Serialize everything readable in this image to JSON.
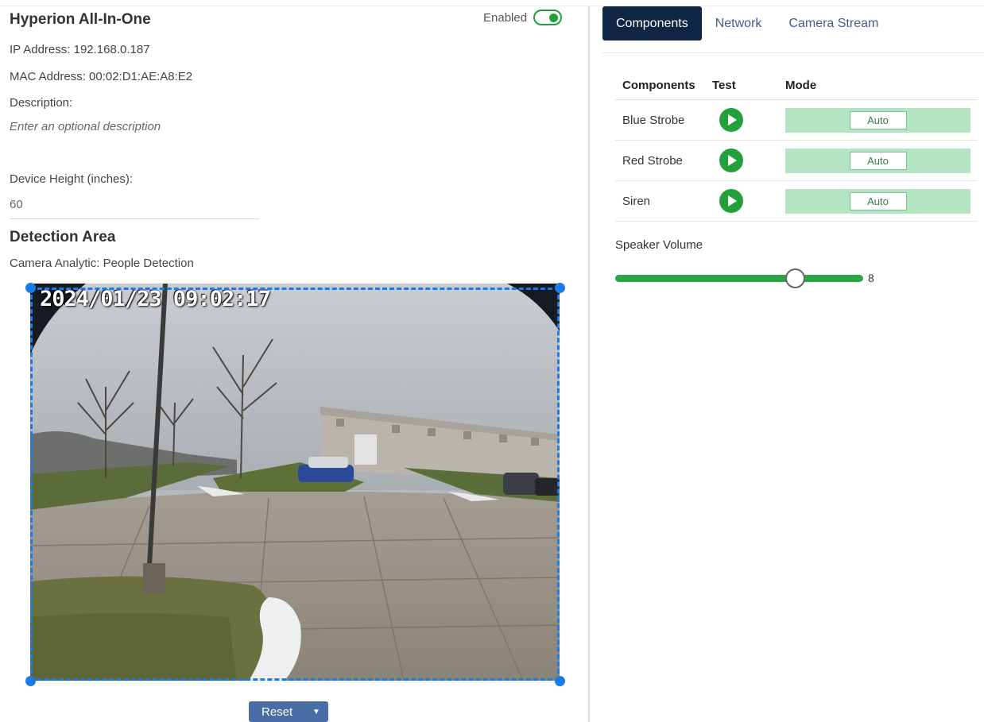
{
  "device": {
    "title": "Hyperion All-In-One",
    "enabled_label": "Enabled",
    "enabled": true,
    "ip_label": "IP Address:",
    "ip_value": "192.168.0.187",
    "mac_label": "MAC Address:",
    "mac_value": "00:02:D1:AE:A8:E2",
    "description_label": "Description:",
    "description_placeholder": "Enter an optional description",
    "height_label": "Device Height (inches):",
    "height_value": "60"
  },
  "detection": {
    "title": "Detection Area",
    "analytic_label": "Camera Analytic:",
    "analytic_value": "People Detection",
    "timestamp": "2024/01/23 09:02:17",
    "reset_label": "Reset"
  },
  "tabs": [
    {
      "label": "Components",
      "active": true
    },
    {
      "label": "Network",
      "active": false
    },
    {
      "label": "Camera Stream",
      "active": false
    }
  ],
  "components_table": {
    "headers": [
      "Components",
      "Test",
      "Mode"
    ],
    "rows": [
      {
        "name": "Blue Strobe",
        "mode": "Auto"
      },
      {
        "name": "Red Strobe",
        "mode": "Auto"
      },
      {
        "name": "Siren",
        "mode": "Auto"
      }
    ]
  },
  "speaker": {
    "label": "Speaker Volume",
    "value": 8,
    "max": 11
  },
  "colors": {
    "accent_green": "#28a745",
    "active_tab": "#0f2744",
    "roi_blue": "#1a7ae8",
    "mode_bg": "#b4e4c1",
    "reset_button": "#4a6da5"
  },
  "icons": [
    "play-icon",
    "chevron-down-icon",
    "toggle-switch"
  ]
}
